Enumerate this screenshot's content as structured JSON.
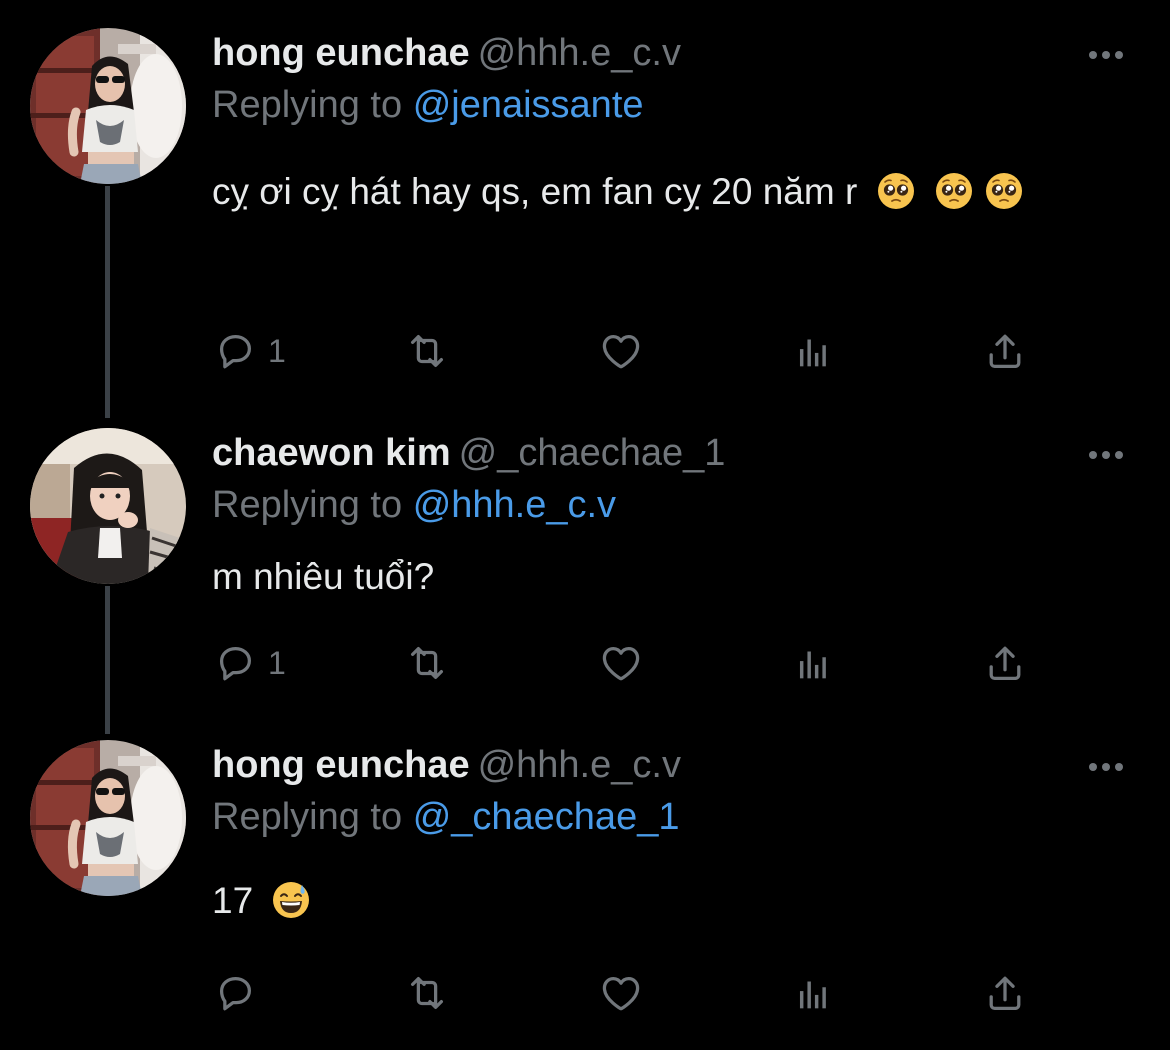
{
  "colors": {
    "background": "#000000",
    "name": "#e7e9ea",
    "muted": "#71767b",
    "mention": "#4a9be8",
    "thread_line": "#3b4147"
  },
  "icons": {
    "more": "more-dots-icon",
    "reply": "reply-icon",
    "retweet": "retweet-icon",
    "like": "heart-icon",
    "views": "views-chart-icon",
    "share": "share-icon"
  },
  "tweets": [
    {
      "name": "hong eunchae",
      "handle": "@hhh.e_c.v",
      "replying_prefix": "Replying to",
      "replying_to": "@jenaissante",
      "text": "cỵ ơi cỵ hát hay qs, em fan cỵ 20 năm r",
      "emoji": "pleading-face-emoji",
      "reply_count": "1"
    },
    {
      "name": "chaewon kim",
      "handle": "@_chaechae_1",
      "replying_prefix": "Replying to",
      "replying_to": "@hhh.e_c.v",
      "text": "m nhiêu tuổi?",
      "reply_count": "1"
    },
    {
      "name": "hong eunchae",
      "handle": "@hhh.e_c.v",
      "replying_prefix": "Replying to",
      "replying_to": "@_chaechae_1",
      "text": "17",
      "emoji": "grinning-sweat-emoji",
      "reply_count": ""
    }
  ]
}
